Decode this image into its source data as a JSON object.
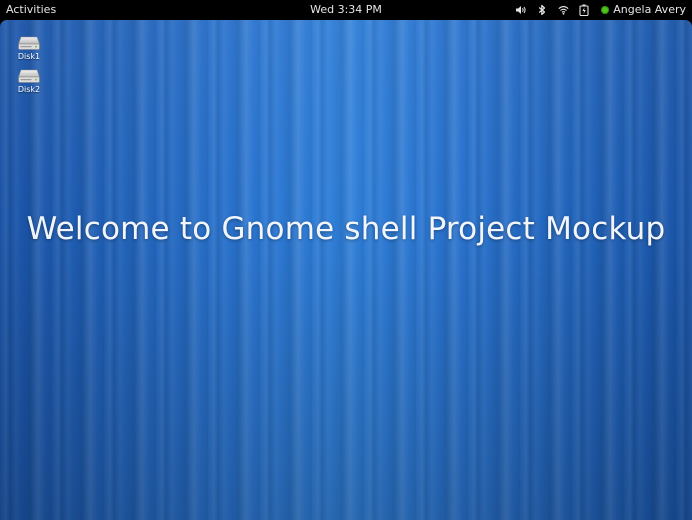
{
  "top_panel": {
    "activities_label": "Activities",
    "clock": "Wed 3:34 PM",
    "status_icons": [
      "volume-icon",
      "bluetooth-icon",
      "wifi-icon",
      "battery-icon"
    ],
    "user_name": "Angela Avery",
    "presence_color": "#4fc21d"
  },
  "desktop": {
    "icons": [
      {
        "label": "Disk1",
        "icon": "disk-icon"
      },
      {
        "label": "Disk2",
        "icon": "disk-icon"
      }
    ],
    "welcome_text": "Welcome to Gnome shell Project Mockup",
    "background_color": "#1d5fb5"
  }
}
